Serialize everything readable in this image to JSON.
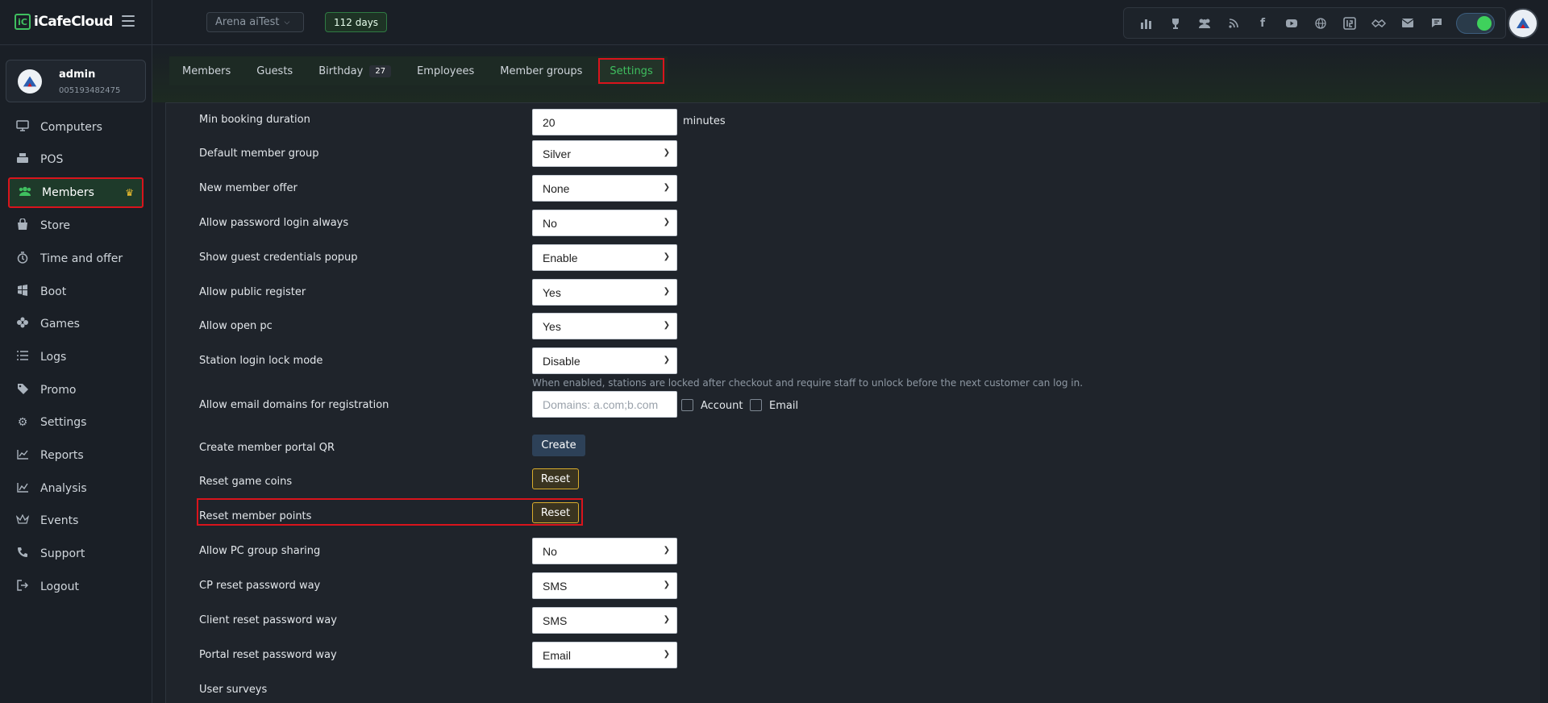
{
  "app": {
    "logo_text": "iCafeCloud",
    "logo_mark": "iC"
  },
  "header": {
    "cafe_name": "Arena aiTest",
    "days_badge": "112 days",
    "icons": [
      "leaderboard-icon",
      "trophy-icon",
      "group-icon",
      "rss-icon",
      "facebook-icon",
      "youtube-icon",
      "globe-icon",
      "app-logo-icon",
      "handshake-icon",
      "mail-icon",
      "chat-icon"
    ]
  },
  "user": {
    "name": "admin",
    "id": "005193482475"
  },
  "sidebar": {
    "items": [
      {
        "label": "Computers",
        "icon": "monitor-icon"
      },
      {
        "label": "POS",
        "icon": "pos-icon"
      },
      {
        "label": "Members",
        "icon": "members-icon"
      },
      {
        "label": "Store",
        "icon": "store-icon"
      },
      {
        "label": "Time and offer",
        "icon": "timer-icon"
      },
      {
        "label": "Boot",
        "icon": "boot-icon"
      },
      {
        "label": "Games",
        "icon": "gamepad-icon"
      },
      {
        "label": "Logs",
        "icon": "list-icon"
      },
      {
        "label": "Promo",
        "icon": "tag-icon"
      },
      {
        "label": "Settings",
        "icon": "gear-icon"
      },
      {
        "label": "Reports",
        "icon": "chart-line-icon"
      },
      {
        "label": "Analysis",
        "icon": "analysis-icon"
      },
      {
        "label": "Events",
        "icon": "crown-icon"
      },
      {
        "label": "Support",
        "icon": "phone-icon"
      },
      {
        "label": "Logout",
        "icon": "logout-icon"
      }
    ]
  },
  "tabs": {
    "members": "Members",
    "guests": "Guests",
    "birthday": "Birthday",
    "birthday_count": "27",
    "employees": "Employees",
    "member_groups": "Member groups",
    "settings": "Settings"
  },
  "settings": {
    "min_booking": {
      "label": "Min booking duration",
      "value": "20",
      "suffix": "minutes"
    },
    "default_group": {
      "label": "Default member group",
      "value": "Silver"
    },
    "new_member_offer": {
      "label": "New member offer",
      "value": "None"
    },
    "password_login": {
      "label": "Allow password login always",
      "value": "No"
    },
    "guest_popup": {
      "label": "Show guest credentials popup",
      "value": "Enable"
    },
    "public_register": {
      "label": "Allow public register",
      "value": "Yes"
    },
    "open_pc": {
      "label": "Allow open pc",
      "value": "Yes"
    },
    "login_lock": {
      "label": "Station login lock mode",
      "value": "Disable",
      "hint": "When enabled, stations are locked after checkout and require staff to unlock before the next customer can log in."
    },
    "email_domains": {
      "label": "Allow email domains for registration",
      "placeholder": "Domains: a.com;b.com",
      "account_label": "Account",
      "email_label": "Email"
    },
    "portal_qr": {
      "label": "Create member portal QR",
      "button": "Create"
    },
    "reset_coins": {
      "label": "Reset game coins",
      "button": "Reset"
    },
    "reset_points": {
      "label": "Reset member points",
      "button": "Reset"
    },
    "pc_group_sharing": {
      "label": "Allow PC group sharing",
      "value": "No"
    },
    "cp_reset": {
      "label": "CP reset password way",
      "value": "SMS"
    },
    "client_reset": {
      "label": "Client reset password way",
      "value": "SMS"
    },
    "portal_reset": {
      "label": "Portal reset password way",
      "value": "Email"
    },
    "user_surveys": {
      "label": "User surveys"
    }
  }
}
